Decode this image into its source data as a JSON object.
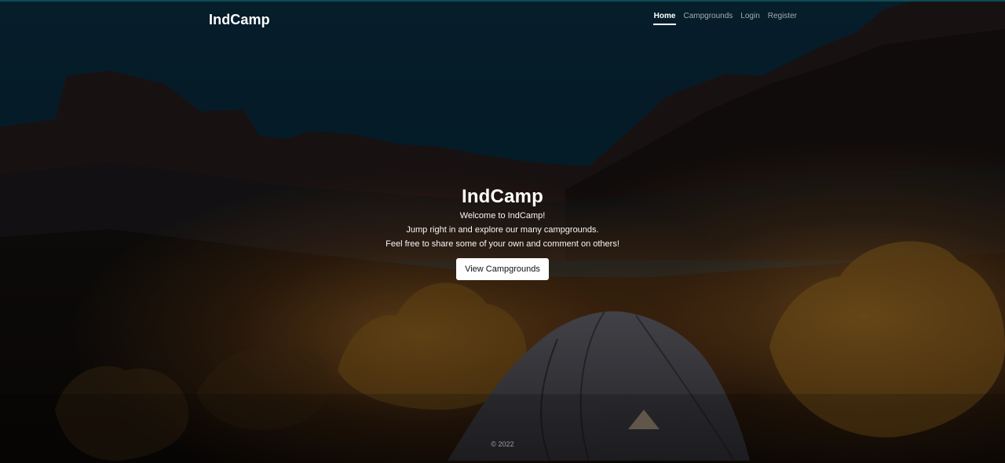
{
  "brand": {
    "name": "IndCamp"
  },
  "nav": {
    "items": [
      {
        "label": "Home",
        "active": true
      },
      {
        "label": "Campgrounds",
        "active": false
      },
      {
        "label": "Login",
        "active": false
      },
      {
        "label": "Register",
        "active": false
      }
    ]
  },
  "hero": {
    "title": "IndCamp",
    "lines": [
      "Welcome to IndCamp!",
      "Jump right in and explore our many campgrounds.",
      "Feel free to share some of your own and comment on others!"
    ],
    "cta_label": "View Campgrounds"
  },
  "footer": {
    "copyright": "© 2022"
  },
  "colors": {
    "top_border": "#0b4b56",
    "sky_top": "#0a2f44",
    "sky_bottom": "#06243a",
    "cliff": "#2b1b1a",
    "desert": "#1b1613",
    "warm_light": "#d08a2a",
    "tent": "#5b5a63",
    "tent_shadow": "#3a3940",
    "button_bg": "#ffffff",
    "button_text": "#111111"
  },
  "icons": {
    "background": "campsite-night-photo"
  }
}
